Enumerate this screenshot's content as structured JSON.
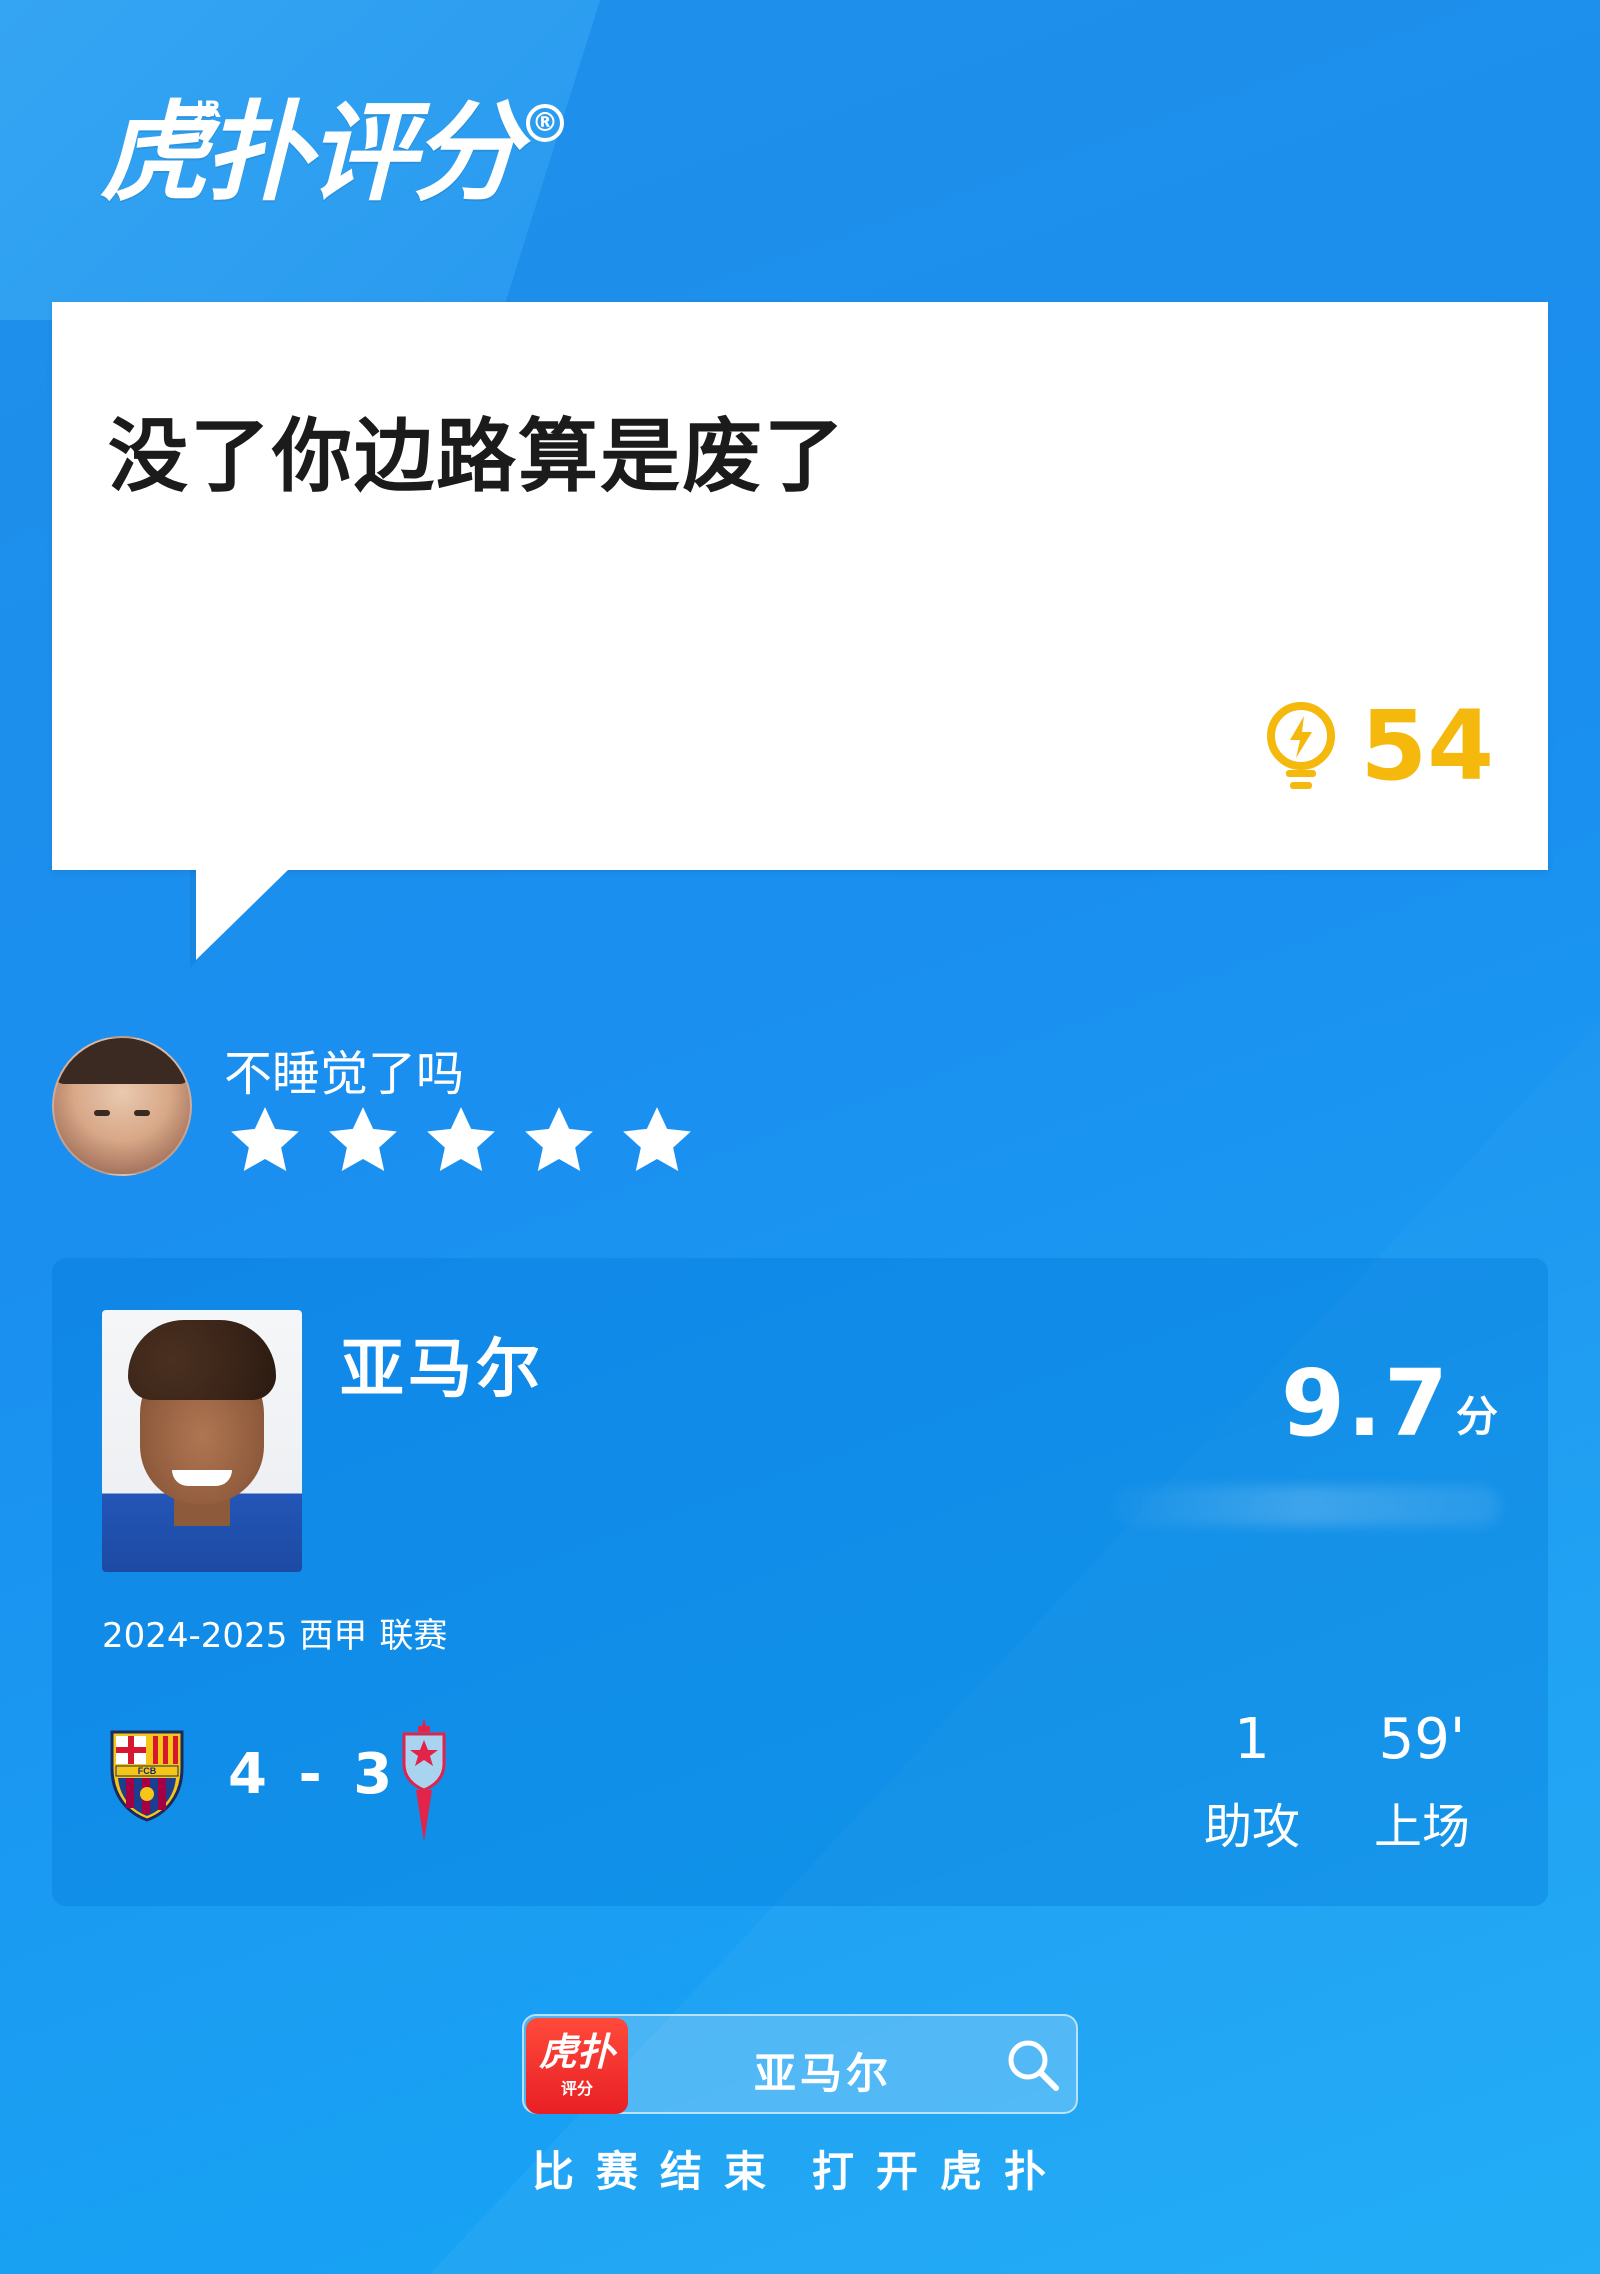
{
  "brand": {
    "logo_text": "虎扑评分",
    "logo_sup": "JR",
    "registered_mark": "®"
  },
  "comment": {
    "text": "没了你边路算是废了",
    "likes": "54",
    "like_icon": "lightbulb-bolt-icon",
    "accent_color": "#F5B80C"
  },
  "user": {
    "name": "不睡觉了吗",
    "stars_rating": 5,
    "stars_max": 5
  },
  "player": {
    "name": "亚马尔",
    "rating": "9.7",
    "rating_unit": "分",
    "season": "2024-2025",
    "league": "西甲",
    "competition": "联赛",
    "score": "4 - 3",
    "home_team_icon": "fc-barcelona-crest-icon",
    "away_team_icon": "celta-vigo-crest-icon",
    "stats": [
      {
        "value": "1",
        "label": "助攻"
      },
      {
        "value": "59'",
        "label": "上场"
      }
    ]
  },
  "search": {
    "app_icon_text": "虎扑",
    "app_icon_sub": "评分",
    "query": "亚马尔",
    "footer_left": "比赛结束",
    "footer_right": "打开虎扑"
  },
  "colors": {
    "background": "#1A8FF0",
    "card": "#FFFFFF",
    "text_dark": "#1B1B1B"
  }
}
